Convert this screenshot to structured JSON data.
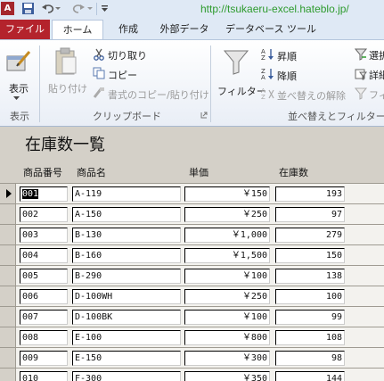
{
  "watermark_url": "http://tsukaeru-excel.hateblo.jp/",
  "app_icon_letter": "A",
  "tabs": [
    "ファイル",
    "ホーム",
    "作成",
    "外部データ",
    "データベース ツール"
  ],
  "ribbon": {
    "view_label": "表示",
    "view_group": "表示",
    "paste_label": "貼り付け",
    "cut_label": "切り取り",
    "copy_label": "コピー",
    "format_painter_label": "書式のコピー/貼り付け",
    "clipboard_group": "クリップボード",
    "filter_label": "フィルター",
    "ascending_label": "昇順",
    "descending_label": "降順",
    "remove_sort_label": "並べ替えの解除",
    "selection_label": "選択",
    "advanced_label": "詳細",
    "toggle_filter_label": "フィ",
    "sort_filter_group": "並べ替えとフィルター"
  },
  "form": {
    "title": "在庫数一覧",
    "headers": {
      "id": "商品番号",
      "name": "商品名",
      "price": "単価",
      "stock": "在庫数"
    },
    "rows": [
      {
        "id": "001",
        "name": "A-119",
        "price": "￥150",
        "stock": "193"
      },
      {
        "id": "002",
        "name": "A-150",
        "price": "￥250",
        "stock": "97"
      },
      {
        "id": "003",
        "name": "B-130",
        "price": "￥1,000",
        "stock": "279"
      },
      {
        "id": "004",
        "name": "B-160",
        "price": "￥1,500",
        "stock": "150"
      },
      {
        "id": "005",
        "name": "B-290",
        "price": "￥100",
        "stock": "138"
      },
      {
        "id": "006",
        "name": "D-100WH",
        "price": "￥250",
        "stock": "100"
      },
      {
        "id": "007",
        "name": "D-100BK",
        "price": "￥100",
        "stock": "99"
      },
      {
        "id": "008",
        "name": "E-100",
        "price": "￥800",
        "stock": "108"
      },
      {
        "id": "009",
        "name": "E-150",
        "price": "￥300",
        "stock": "98"
      },
      {
        "id": "010",
        "name": "F-300",
        "price": "￥350",
        "stock": "144"
      }
    ]
  }
}
